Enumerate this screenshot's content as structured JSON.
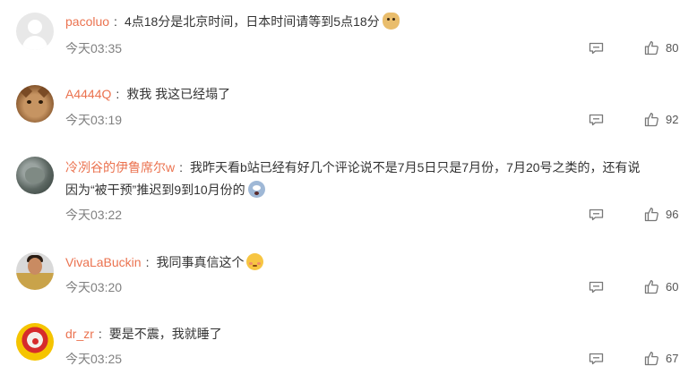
{
  "comments": [
    {
      "username": "pacoluo",
      "text": "4点18分是北京时间，日本时间请等到5点18分",
      "emoji": "doge-emoji",
      "time": "今天03:35",
      "likes": "80",
      "avatar": "default-avatar"
    },
    {
      "username": "A4444Q",
      "text": "救我 我这已经塌了",
      "time": "今天03:19",
      "likes": "92",
      "avatar": "cat-avatar"
    },
    {
      "username": "冷冽谷的伊鲁席尔w",
      "text": "我昨天看b站已经有好几个评论说不是7月5日只是7月份，7月20号之类的，还有说",
      "text_line2": "因为“被干预”推迟到9到10月份的",
      "emoji": "scared-emoji",
      "time": "今天03:22",
      "likes": "96",
      "avatar": "rock-avatar"
    },
    {
      "username": "VivaLaBuckin",
      "text": "我同事真信这个",
      "emoji": "shy-emoji",
      "time": "今天03:20",
      "likes": "60",
      "avatar": "person-avatar"
    },
    {
      "username": "dr_zr",
      "text": "要是不震，我就睡了",
      "time": "今天03:25",
      "likes": "67",
      "avatar": "clown-avatar"
    }
  ],
  "colors": {
    "username": "#eb7350",
    "time": "#808080",
    "icon": "#777777"
  },
  "icons": {
    "reply": "reply-icon",
    "like": "thumbs-up-icon"
  }
}
